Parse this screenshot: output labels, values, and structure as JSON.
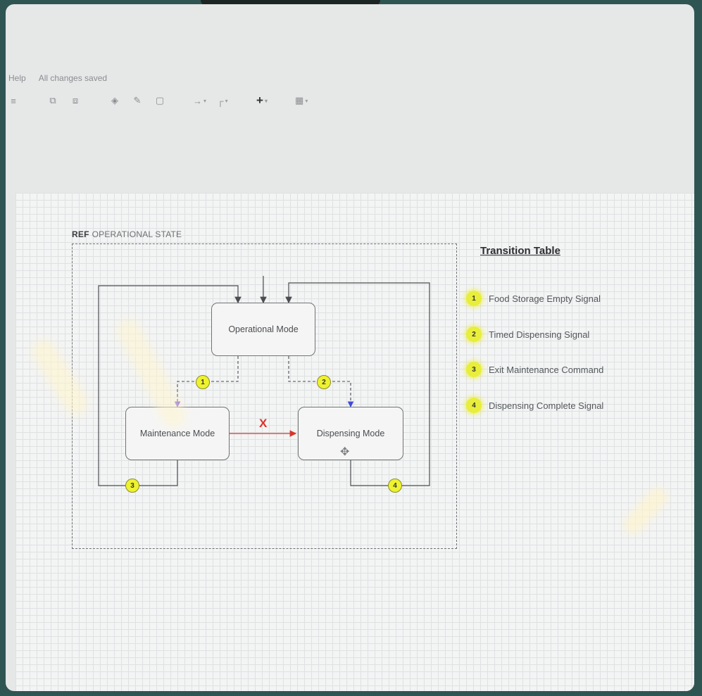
{
  "app": {
    "menu": {
      "help": "Help",
      "save_status": "All changes saved"
    },
    "toolbar": {
      "items": [
        "format-icon",
        "to-front-icon",
        "to-back-icon",
        "fill-color-icon",
        "line-color-icon",
        "shadow-icon",
        "connection-icon",
        "waypoints-icon",
        "insert-icon",
        "table-icon"
      ],
      "insert_glyph": "+"
    }
  },
  "diagram": {
    "frame": {
      "keyword": "REF",
      "label": "OPERATIONAL STATE"
    },
    "states": {
      "operational": "Operational Mode",
      "maintenance": "Maintenance Mode",
      "dispensing": "Dispensing Mode"
    },
    "transitions": [
      {
        "id": "1",
        "from": "Operational Mode",
        "to": "Maintenance Mode"
      },
      {
        "id": "2",
        "from": "Operational Mode",
        "to": "Dispensing Mode"
      },
      {
        "id": "3",
        "from": "Maintenance Mode",
        "to": "Operational Mode"
      },
      {
        "id": "4",
        "from": "Dispensing Mode",
        "to": "Operational Mode"
      }
    ],
    "blocked_marker": "X",
    "colors": {
      "badge": "#eef22f",
      "blocked": "#d9342b",
      "trigger_arrow": "#3f4bd8"
    }
  },
  "transition_table": {
    "title": "Transition Table",
    "rows": [
      {
        "id": "1",
        "label": "Food Storage Empty Signal"
      },
      {
        "id": "2",
        "label": "Timed Dispensing Signal"
      },
      {
        "id": "3",
        "label": "Exit Maintenance Command"
      },
      {
        "id": "4",
        "label": "Dispensing Complete Signal"
      }
    ]
  }
}
